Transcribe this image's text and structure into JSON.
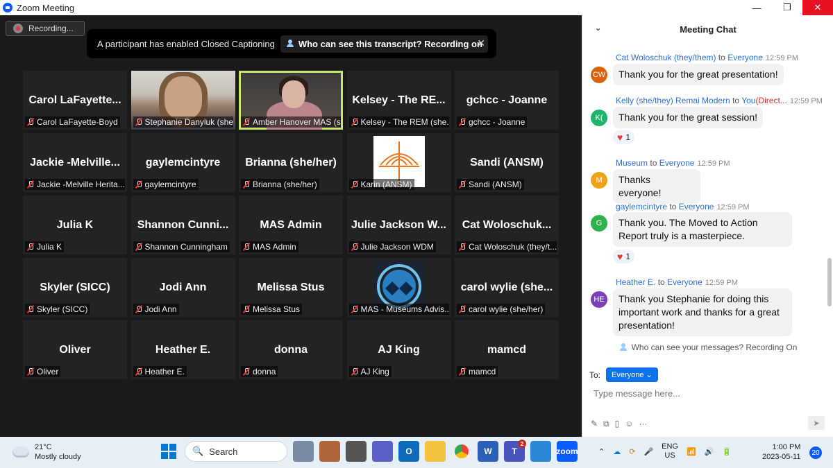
{
  "window": {
    "title": "Zoom Meeting",
    "minimize_icon": "—",
    "restore_icon": "❐",
    "close_icon": "✕"
  },
  "recording": {
    "label": "Recording..."
  },
  "caption_banner": {
    "text": "A participant has enabled Closed Captioning",
    "link": "Who can see this transcript? Recording on",
    "close": "✕"
  },
  "participants": [
    {
      "display": "Carol LaFayette...",
      "name": "Carol LaFayette-Boyd"
    },
    {
      "display": "",
      "name": "Stephanie Danyluk (she/h...",
      "video": "video1"
    },
    {
      "display": "",
      "name": "Amber Hanover MAS (she...",
      "video": "video2",
      "active": true
    },
    {
      "display": "Kelsey - The RE...",
      "name": "Kelsey - The REM (she..."
    },
    {
      "display": "gchcc - Joanne",
      "name": "gchcc - Joanne"
    },
    {
      "display": "Jackie -Melville...",
      "name": "Jackie -Melville Herita..."
    },
    {
      "display": "gaylemcintyre",
      "name": "gaylemcintyre"
    },
    {
      "display": "Brianna (she/her)",
      "name": "Brianna (she/her)"
    },
    {
      "display": "",
      "name": "Karin (ANSM)",
      "logo": "karin"
    },
    {
      "display": "Sandi (ANSM)",
      "name": "Sandi (ANSM)"
    },
    {
      "display": "Julia K",
      "name": "Julia K"
    },
    {
      "display": "Shannon Cunni...",
      "name": "Shannon Cunningham"
    },
    {
      "display": "MAS Admin",
      "name": "MAS Admin"
    },
    {
      "display": "Julie Jackson W...",
      "name": "Julie Jackson WDM"
    },
    {
      "display": "Cat Woloschuk...",
      "name": "Cat Woloschuk (they/t..."
    },
    {
      "display": "Skyler (SICC)",
      "name": "Skyler (SICC)"
    },
    {
      "display": "Jodi Ann",
      "name": "Jodi Ann"
    },
    {
      "display": "Melissa Stus",
      "name": "Melissa Stus"
    },
    {
      "display": "",
      "name": "MAS - Museums Advis...",
      "logo": "mas"
    },
    {
      "display": "carol wylie (she...",
      "name": "carol wylie (she/her)"
    },
    {
      "display": "Oliver",
      "name": "Oliver"
    },
    {
      "display": "Heather E.",
      "name": "Heather E."
    },
    {
      "display": "donna",
      "name": "donna"
    },
    {
      "display": "AJ King",
      "name": "AJ King"
    },
    {
      "display": "mamcd",
      "name": "mamcd"
    }
  ],
  "chat": {
    "title": "Meeting Chat",
    "collapse_icon": "⌄",
    "messages": [
      {
        "initials": "CW",
        "avatar_color": "#d9630f",
        "from": "Cat Woloschuk (they/them)",
        "to_word": "to",
        "to": "Everyone",
        "dm": "",
        "time": "12:59 PM",
        "text": "Thank you for the great presentation!",
        "reaction": ""
      },
      {
        "initials": "K(",
        "avatar_color": "#1fb36b",
        "from": "Kelly (she/they) Remai Modern",
        "to_word": "to",
        "to": "You",
        "dm": "(Direct...",
        "time": "12:59 PM",
        "text": "Thank you for the great session!",
        "reaction": "1"
      },
      {
        "initials": "M",
        "avatar_color": "#f0a21a",
        "from": "Museum",
        "to_word": "to",
        "to": "Everyone",
        "dm": "",
        "time": "12:59 PM",
        "text": "Thanks everyone!",
        "reaction": ""
      },
      {
        "initials": "G",
        "avatar_color": "#2fb24c",
        "from": "gaylemcintyre",
        "to_word": "to",
        "to": "Everyone",
        "dm": "",
        "time": "12:59 PM",
        "text": "Thank you.  The Moved to Action Report truly is a masterpiece.",
        "reaction": "1"
      },
      {
        "initials": "HE",
        "avatar_color": "#7b3fb8",
        "from": "Heather E.",
        "to_word": "to",
        "to": "Everyone",
        "dm": "",
        "time": "12:59 PM",
        "text": "Thank you Stephanie for doing this important work and thanks for a great presentation!",
        "reaction": ""
      }
    ],
    "who_can_see": "Who can see your messages? Recording On",
    "to_label": "To:",
    "to_button": "Everyone",
    "input_placeholder": "Type message here...",
    "more_icon": "···"
  },
  "taskbar": {
    "temperature": "21°C",
    "weather": "Mostly cloudy",
    "search": "Search",
    "lang_top": "ENG",
    "lang_bottom": "US",
    "time": "1:00 PM",
    "date": "2023-05-11",
    "notifications": "20",
    "teams_badge": "2"
  }
}
